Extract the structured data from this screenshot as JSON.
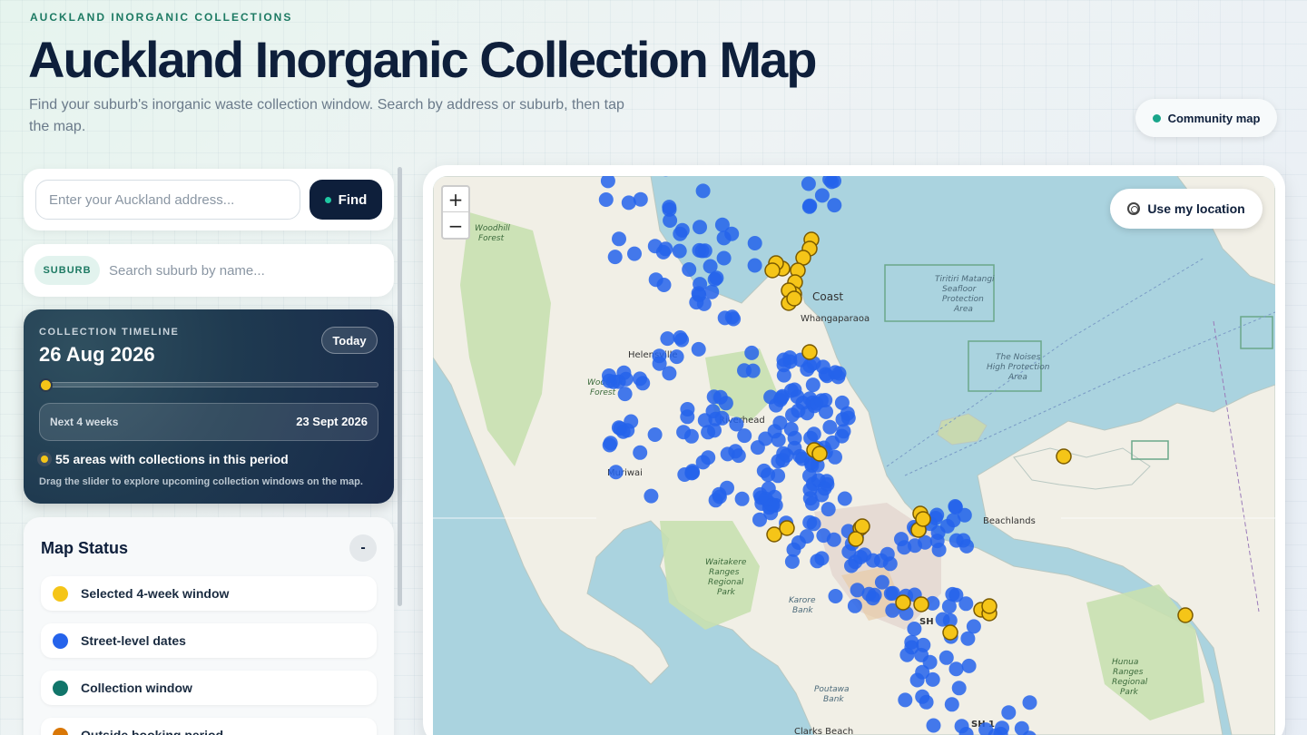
{
  "header": {
    "eyebrow": "AUCKLAND INORGANIC COLLECTIONS",
    "title": "Auckland Inorganic Collection Map",
    "subtitle": "Find your suburb's inorganic waste collection window. Search by address or suburb, then tap the map.",
    "community_label": "Community map"
  },
  "address": {
    "placeholder": "Enter your Auckland address...",
    "find_label": "Find"
  },
  "suburb": {
    "chip": "SUBURB",
    "placeholder": "Search suburb by name..."
  },
  "timeline": {
    "label": "COLLECTION TIMELINE",
    "date": "26 Aug 2026",
    "today_label": "Today",
    "slider_position": 0,
    "range_label": "Next 4 weeks",
    "range_end": "23 Sept 2026",
    "areas_text": "55 areas with collections in this period",
    "hint": "Drag the slider to explore upcoming collection windows on the map."
  },
  "status": {
    "title": "Map Status",
    "collapse": "-",
    "legend": [
      {
        "label": "Selected 4-week window",
        "color": "#f5c518"
      },
      {
        "label": "Street-level dates",
        "color": "#2563eb"
      },
      {
        "label": "Collection window",
        "color": "#11756a"
      },
      {
        "label": "Outside booking period",
        "color": "#d97706"
      }
    ]
  },
  "map": {
    "zoom_in": "+",
    "zoom_out": "−",
    "location_label": "Use my location",
    "labels": {
      "woodhill_forest_n": "Woodhill",
      "woodhill_forest_n2": "Forest",
      "woodhill_forest_s": "Woodhill",
      "woodhill_forest_s2": "Forest",
      "helensville": "Helensville",
      "hibiscus_coast": "Coast",
      "whangaparaoa": "Whangaparaoa",
      "riverhead": "Riverhead",
      "muriwai": "Muriwai",
      "tiritiri": "Tiritiri Matangi",
      "tiritiri2": "Seafloor",
      "tiritiri3": "Protection",
      "tiritiri4": "Area",
      "noises": "The Noises",
      "noises2": "High Protection",
      "noises3": "Area",
      "beachlands": "Beachlands",
      "waitakere": "Waitakere",
      "waitakere2": "Ranges",
      "waitakere3": "Regional",
      "waitakere4": "Park",
      "karore": "Karore",
      "karore2": "Bank",
      "hunua": "Hunua",
      "hunua2": "Ranges",
      "hunua3": "Regional",
      "hunua4": "Park",
      "poutawa": "Poutawa",
      "poutawa2": "Bank",
      "clarks": "Clarks Beach",
      "sh1": "SH 1",
      "sh16": "SH"
    }
  }
}
